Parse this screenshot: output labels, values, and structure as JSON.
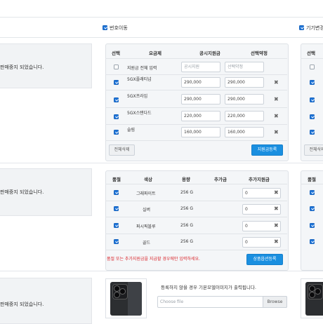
{
  "top_checkboxes": {
    "number_port_label": "번호이동",
    "device_change_label": "기기변경"
  },
  "notice_text": "판매중지 되었습니다.",
  "plan_table": {
    "headers": [
      "선택",
      "요금제",
      "공시지원금",
      "선택약정"
    ],
    "bulk_row": {
      "label": "지원금 전체 입력",
      "subsidy_placeholder": "공시지원",
      "contract_placeholder": "선택약정"
    },
    "rows": [
      {
        "plan": "5GX플래티넘",
        "subsidy": "290,000",
        "contract": "290,000"
      },
      {
        "plan": "5GX프라임",
        "subsidy": "290,000",
        "contract": "290,000"
      },
      {
        "plan": "5GX스탠다드",
        "subsidy": "220,000",
        "contract": "220,000"
      },
      {
        "plan": "슬림",
        "subsidy": "160,000",
        "contract": "160,000"
      }
    ],
    "delete_all_button": "전체삭제",
    "register_button": "지원금등록"
  },
  "color_table": {
    "headers": [
      "품절",
      "색상",
      "용량",
      "추가금",
      "추가지원금"
    ],
    "rows": [
      {
        "color": "그래파이트",
        "capacity": "256 G",
        "extra_support": "0"
      },
      {
        "color": "실버",
        "capacity": "256 G",
        "extra_support": "0"
      },
      {
        "color": "퍼시픽블루",
        "capacity": "256 G",
        "extra_support": "0"
      },
      {
        "color": "골드",
        "capacity": "256 G",
        "extra_support": "0"
      }
    ],
    "warning": "품절 또는 추가지원금을 지급할 경우에만 입력하세요.",
    "register_button": "상품옵션등록"
  },
  "image_section": {
    "info_text": "등록하지 않을 경우 기본모델이미지가 출력됩니다.",
    "file_placeholder": "Choose file",
    "browse_button": "Browse"
  },
  "right_column": {
    "plan_headers": [
      "선택"
    ],
    "color_headers": [
      "품절"
    ],
    "delete_all_button": "전체삭제"
  },
  "colors": {
    "accent": "#1a8fe0",
    "checkbox": "#1e74d8",
    "warning": "#d9262b"
  }
}
